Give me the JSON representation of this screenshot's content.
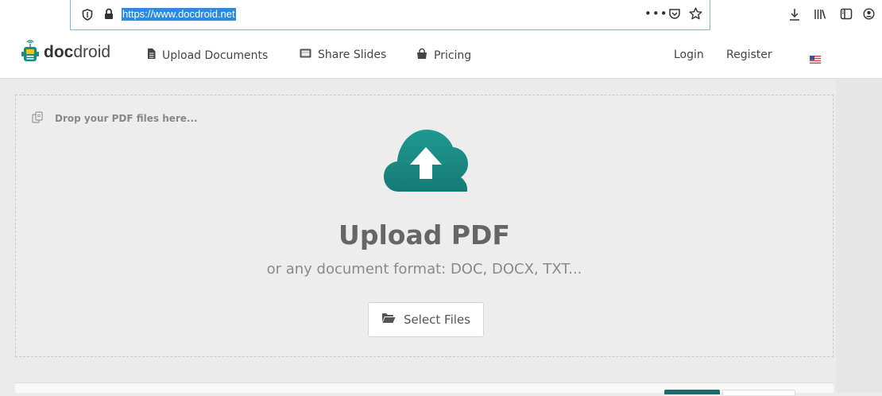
{
  "browser": {
    "url": "https://www.docdroid.net",
    "more_glyph": "•••",
    "icons": [
      "shield-icon",
      "lock-icon",
      "pocket-icon",
      "star-icon",
      "download-icon",
      "library-icon",
      "sidebar-icon",
      "account-icon"
    ]
  },
  "header": {
    "logo_bold": "doc",
    "logo_light": "droid",
    "nav": [
      {
        "label": "Upload Documents",
        "icon": "document-icon"
      },
      {
        "label": "Share Slides",
        "icon": "slides-icon"
      },
      {
        "label": "Pricing",
        "icon": "shopping-bag-icon"
      }
    ],
    "login": "Login",
    "register": "Register",
    "language_icon": "us-flag-icon"
  },
  "upload": {
    "drop_hint": "Drop your PDF files here...",
    "title": "Upload PDF",
    "subtitle": "or any document format: DOC, DOCX, TXT...",
    "button_label": "Select Files",
    "accent_color": "#1a8a84"
  }
}
